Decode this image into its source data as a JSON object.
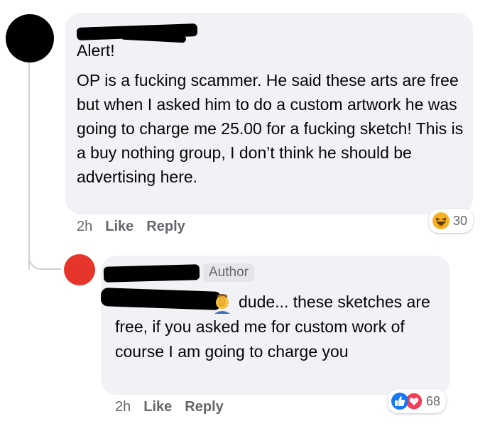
{
  "comment": {
    "heading": "Alert!",
    "body": "OP is a fucking scammer. He said these arts are free but when I asked him to do a custom artwork he was going to charge me 25.00 for a fucking sketch! This is a buy nothing group, I don’t think he should be advertising here.",
    "time": "2h",
    "like_label": "Like",
    "reply_label": "Reply",
    "reaction_count": "30",
    "reaction_icons": [
      "haha-icon"
    ]
  },
  "reply": {
    "badge": "Author",
    "text": "dude... these sketches are free, if you asked me for custom work of course I am going to charge you",
    "inline_emoji": "facepalm-emoji-icon",
    "time": "2h",
    "like_label": "Like",
    "reply_label": "Reply",
    "reaction_count": "68",
    "reaction_icons": [
      "like-icon",
      "love-icon"
    ]
  },
  "colors": {
    "bubble": "#f0f2f5",
    "avatar_first": "#000000",
    "avatar_second": "#e8352b",
    "like_blue": "#1877f2",
    "love_red": "#f33e58",
    "haha_yellow": "#f7b125"
  }
}
